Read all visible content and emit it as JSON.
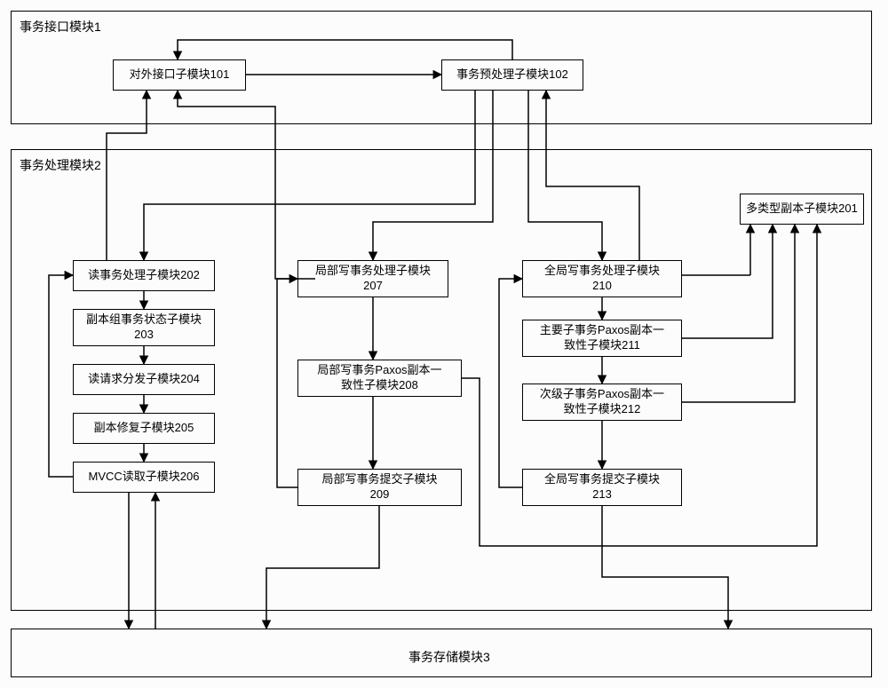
{
  "modules": {
    "interface": {
      "label": "事务接口模块1"
    },
    "processing": {
      "label": "事务处理模块2"
    },
    "storage": {
      "label": "事务存储模块3"
    }
  },
  "boxes": {
    "b101": "对外接口子模块101",
    "b102": "事务预处理子模块102",
    "b201": "多类型副本子模块201",
    "b202": "读事务处理子模块202",
    "b203_l1": "副本组事务状态子模块",
    "b203_l2": "203",
    "b204": "读请求分发子模块204",
    "b205": "副本修复子模块205",
    "b206": "MVCC读取子模块206",
    "b207_l1": "局部写事务处理子模块",
    "b207_l2": "207",
    "b208_l1": "局部写事务Paxos副本一",
    "b208_l2": "致性子模块208",
    "b209_l1": "局部写事务提交子模块",
    "b209_l2": "209",
    "b210_l1": "全局写事务处理子模块",
    "b210_l2": "210",
    "b211_l1": "主要子事务Paxos副本一",
    "b211_l2": "致性子模块211",
    "b212_l1": "次级子事务Paxos副本一",
    "b212_l2": "致性子模块212",
    "b213_l1": "全局写事务提交子模块",
    "b213_l2": "213"
  }
}
